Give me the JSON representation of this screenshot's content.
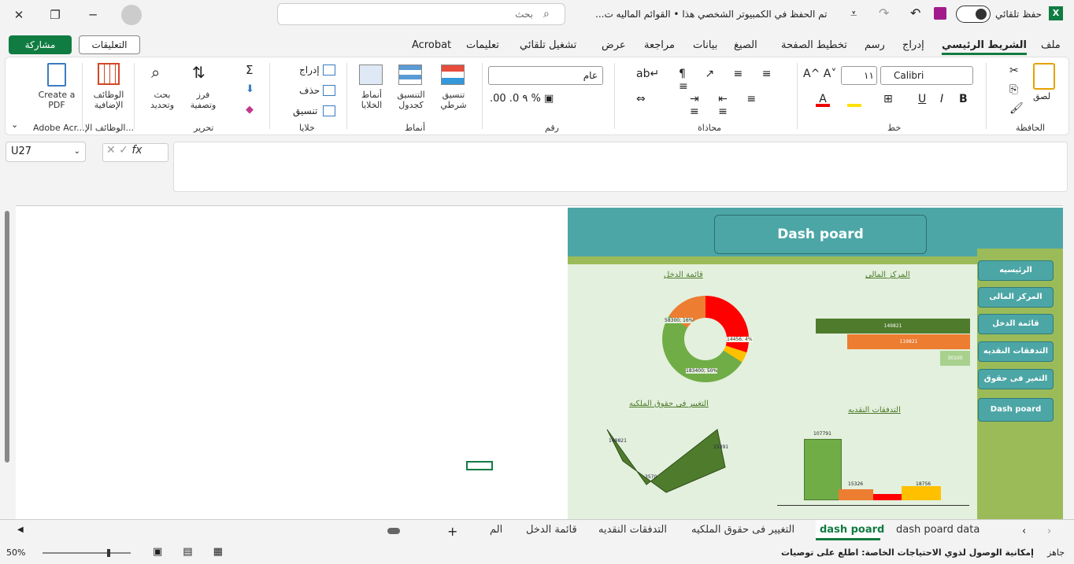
{
  "titlebar": {
    "autosave_label": "حفظ تلقائي",
    "doc_title": "القوائم الماليه ت...",
    "save_status": "تم الحفظ في الكمبيوتر الشخصي هذا",
    "search_placeholder": "بحث"
  },
  "menu": [
    "ملف",
    "الشريط الرئيسي",
    "إدراج",
    "رسم",
    "تخطيط الصفحة",
    "الصيغ",
    "بيانات",
    "مراجعة",
    "عرض",
    "تشغيل تلقائي",
    "تعليمات",
    "Acrobat"
  ],
  "comments_label": "التعليقات",
  "share_label": "مشاركة",
  "ribbon": {
    "paste": "لصق",
    "clipboard": "الحافظة",
    "font_name": "Calibri",
    "font_size": "١١",
    "font_group": "خط",
    "align_group": "محاذاة",
    "number_format": "عام",
    "number_group": "رقم",
    "cond_format": "تنسيق شرطي",
    "table_format": "التنسيق كجدول",
    "cell_styles": "أنماط الخلايا",
    "styles_group": "أنماط",
    "insert": "إدراج",
    "delete": "حذف",
    "format": "تنسيق",
    "cells_group": "خلايا",
    "sort": "فرز وتصفية",
    "find": "بحث وتحديد",
    "edit_group": "تحرير",
    "addins": "الوظائف الإضافية",
    "addins_group": "الوظائف الإ...",
    "create_pdf": "Create a PDF",
    "adobe_group": "Adobe Acr..."
  },
  "namebox": "U27",
  "fx": "fx",
  "dashboard": {
    "title": "Dash poard",
    "nav": [
      "الرئيسيه",
      "المركز المالى",
      "قائمة الدخل",
      "التدفقات النقديه",
      "التغير فى حقوق",
      "Dash poard"
    ],
    "chart1_title": "المركز المالى",
    "chart2_title": "قائمة الدخل",
    "chart3_title": "التدفقات النقديه",
    "chart4_title": "التغيير فى حقوق الملكيه"
  },
  "chart_data": [
    {
      "type": "bar",
      "title": "المركز المالى",
      "values": [
        149821,
        119821,
        30100
      ],
      "colors": [
        "#4f7b2d",
        "#ed7d31",
        "#a9d18e"
      ]
    },
    {
      "type": "pie",
      "title": "قائمة الدخل",
      "slices": [
        {
          "label": "183400; 50%",
          "value": 50,
          "color": "#70ad47"
        },
        {
          "label": "58300; 16%",
          "value": 16,
          "color": "#ed7d31"
        },
        {
          "label": "14456; 4%",
          "value": 4,
          "color": "#ffc000"
        },
        {
          "label": "",
          "value": 30,
          "color": "#ff0000"
        }
      ]
    },
    {
      "type": "bar",
      "title": "التدفقات النقديه",
      "values": [
        107791,
        15326,
        0,
        18756
      ],
      "colors": [
        "#70ad47",
        "#ed7d31",
        "#ff0000",
        "#ffc000"
      ]
    },
    {
      "type": "area",
      "title": "التغيير فى حقوق الملكيه",
      "labels": [
        "149821",
        "3570",
        "15391"
      ]
    }
  ],
  "sheets": [
    "dash poard data",
    "dash poard",
    "التغيير فى حقوق الملكيه",
    "التدفقات النقديه",
    "قائمة الدخل",
    "الم"
  ],
  "status": {
    "ready": "جاهز",
    "accessibility": "إمكانية الوصول لذوي الاحتياجات الخاصة: اطلع على توصيات",
    "zoom": "50%"
  }
}
